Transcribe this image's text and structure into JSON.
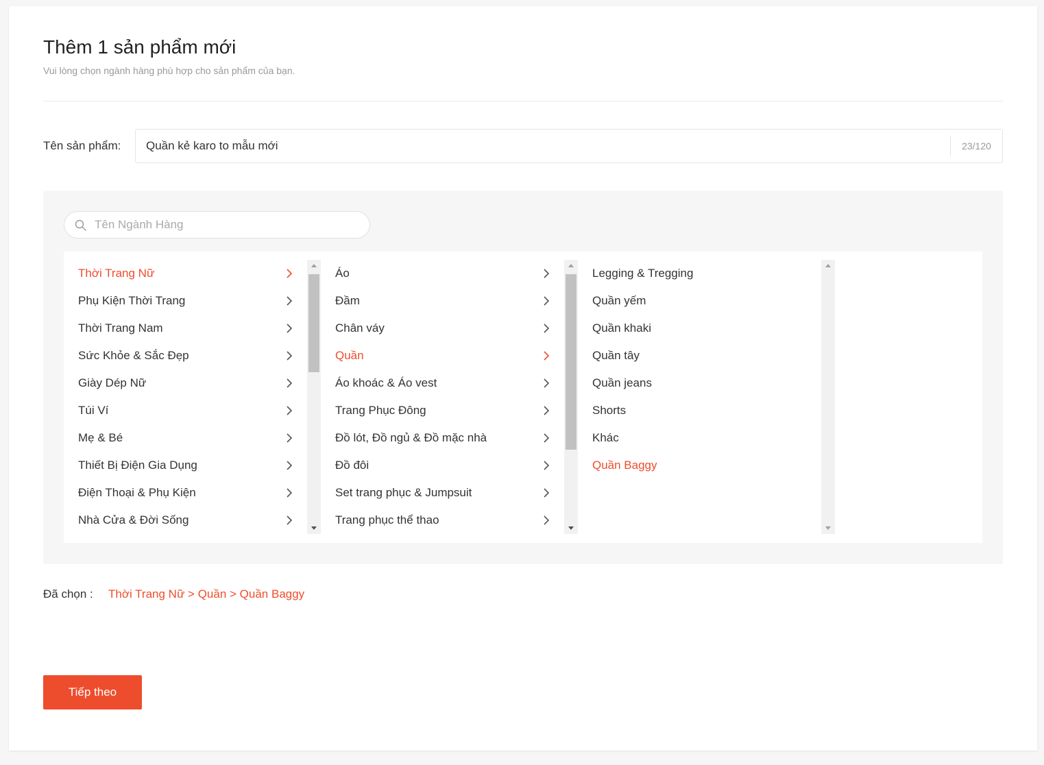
{
  "header": {
    "title": "Thêm 1 sản phẩm mới",
    "subtitle": "Vui lòng chọn ngành hàng phù hợp cho sản phẩm của bạn."
  },
  "product_name": {
    "label": "Tên sản phẩm:",
    "value": "Quần kẻ karo to mẫu mới",
    "char_count": "23/120"
  },
  "category_search": {
    "placeholder": "Tên Ngành Hàng",
    "icon": "search-icon"
  },
  "columns": [
    {
      "items": [
        {
          "label": "Thời Trang Nữ",
          "active": true,
          "has_children": true
        },
        {
          "label": "Phụ Kiện Thời Trang",
          "active": false,
          "has_children": true
        },
        {
          "label": "Thời Trang Nam",
          "active": false,
          "has_children": true
        },
        {
          "label": "Sức Khỏe & Sắc Đẹp",
          "active": false,
          "has_children": true
        },
        {
          "label": "Giày Dép Nữ",
          "active": false,
          "has_children": true
        },
        {
          "label": "Túi Ví",
          "active": false,
          "has_children": true
        },
        {
          "label": "Mẹ & Bé",
          "active": false,
          "has_children": true
        },
        {
          "label": "Thiết Bị Điện Gia Dụng",
          "active": false,
          "has_children": true
        },
        {
          "label": "Điện Thoại & Phụ Kiện",
          "active": false,
          "has_children": true
        },
        {
          "label": "Nhà Cửa & Đời Sống",
          "active": false,
          "has_children": true
        }
      ]
    },
    {
      "items": [
        {
          "label": "Áo",
          "active": false,
          "has_children": true
        },
        {
          "label": "Đầm",
          "active": false,
          "has_children": true
        },
        {
          "label": "Chân váy",
          "active": false,
          "has_children": true
        },
        {
          "label": "Quần",
          "active": true,
          "has_children": true
        },
        {
          "label": "Áo khoác & Áo vest",
          "active": false,
          "has_children": true
        },
        {
          "label": "Trang Phục Đông",
          "active": false,
          "has_children": true
        },
        {
          "label": "Đồ lót, Đồ ngủ & Đồ mặc nhà",
          "active": false,
          "has_children": true
        },
        {
          "label": "Đồ đôi",
          "active": false,
          "has_children": true
        },
        {
          "label": "Set trang phục & Jumpsuit",
          "active": false,
          "has_children": true
        },
        {
          "label": "Trang phục thể thao",
          "active": false,
          "has_children": true
        }
      ]
    },
    {
      "items": [
        {
          "label": "Legging & Tregging",
          "active": false,
          "has_children": false
        },
        {
          "label": "Quần yếm",
          "active": false,
          "has_children": false
        },
        {
          "label": "Quần khaki",
          "active": false,
          "has_children": false
        },
        {
          "label": "Quần tây",
          "active": false,
          "has_children": false
        },
        {
          "label": "Quần jeans",
          "active": false,
          "has_children": false
        },
        {
          "label": "Shorts",
          "active": false,
          "has_children": false
        },
        {
          "label": "Khác",
          "active": false,
          "has_children": false
        },
        {
          "label": "Quần Baggy",
          "active": true,
          "has_children": false
        }
      ]
    }
  ],
  "selected": {
    "label": "Đã chọn :",
    "path": "Thời Trang Nữ > Quần > Quần Baggy"
  },
  "actions": {
    "next_label": "Tiếp theo"
  },
  "colors": {
    "accent": "#ee4d2d",
    "text": "#333333",
    "muted": "#999999"
  }
}
